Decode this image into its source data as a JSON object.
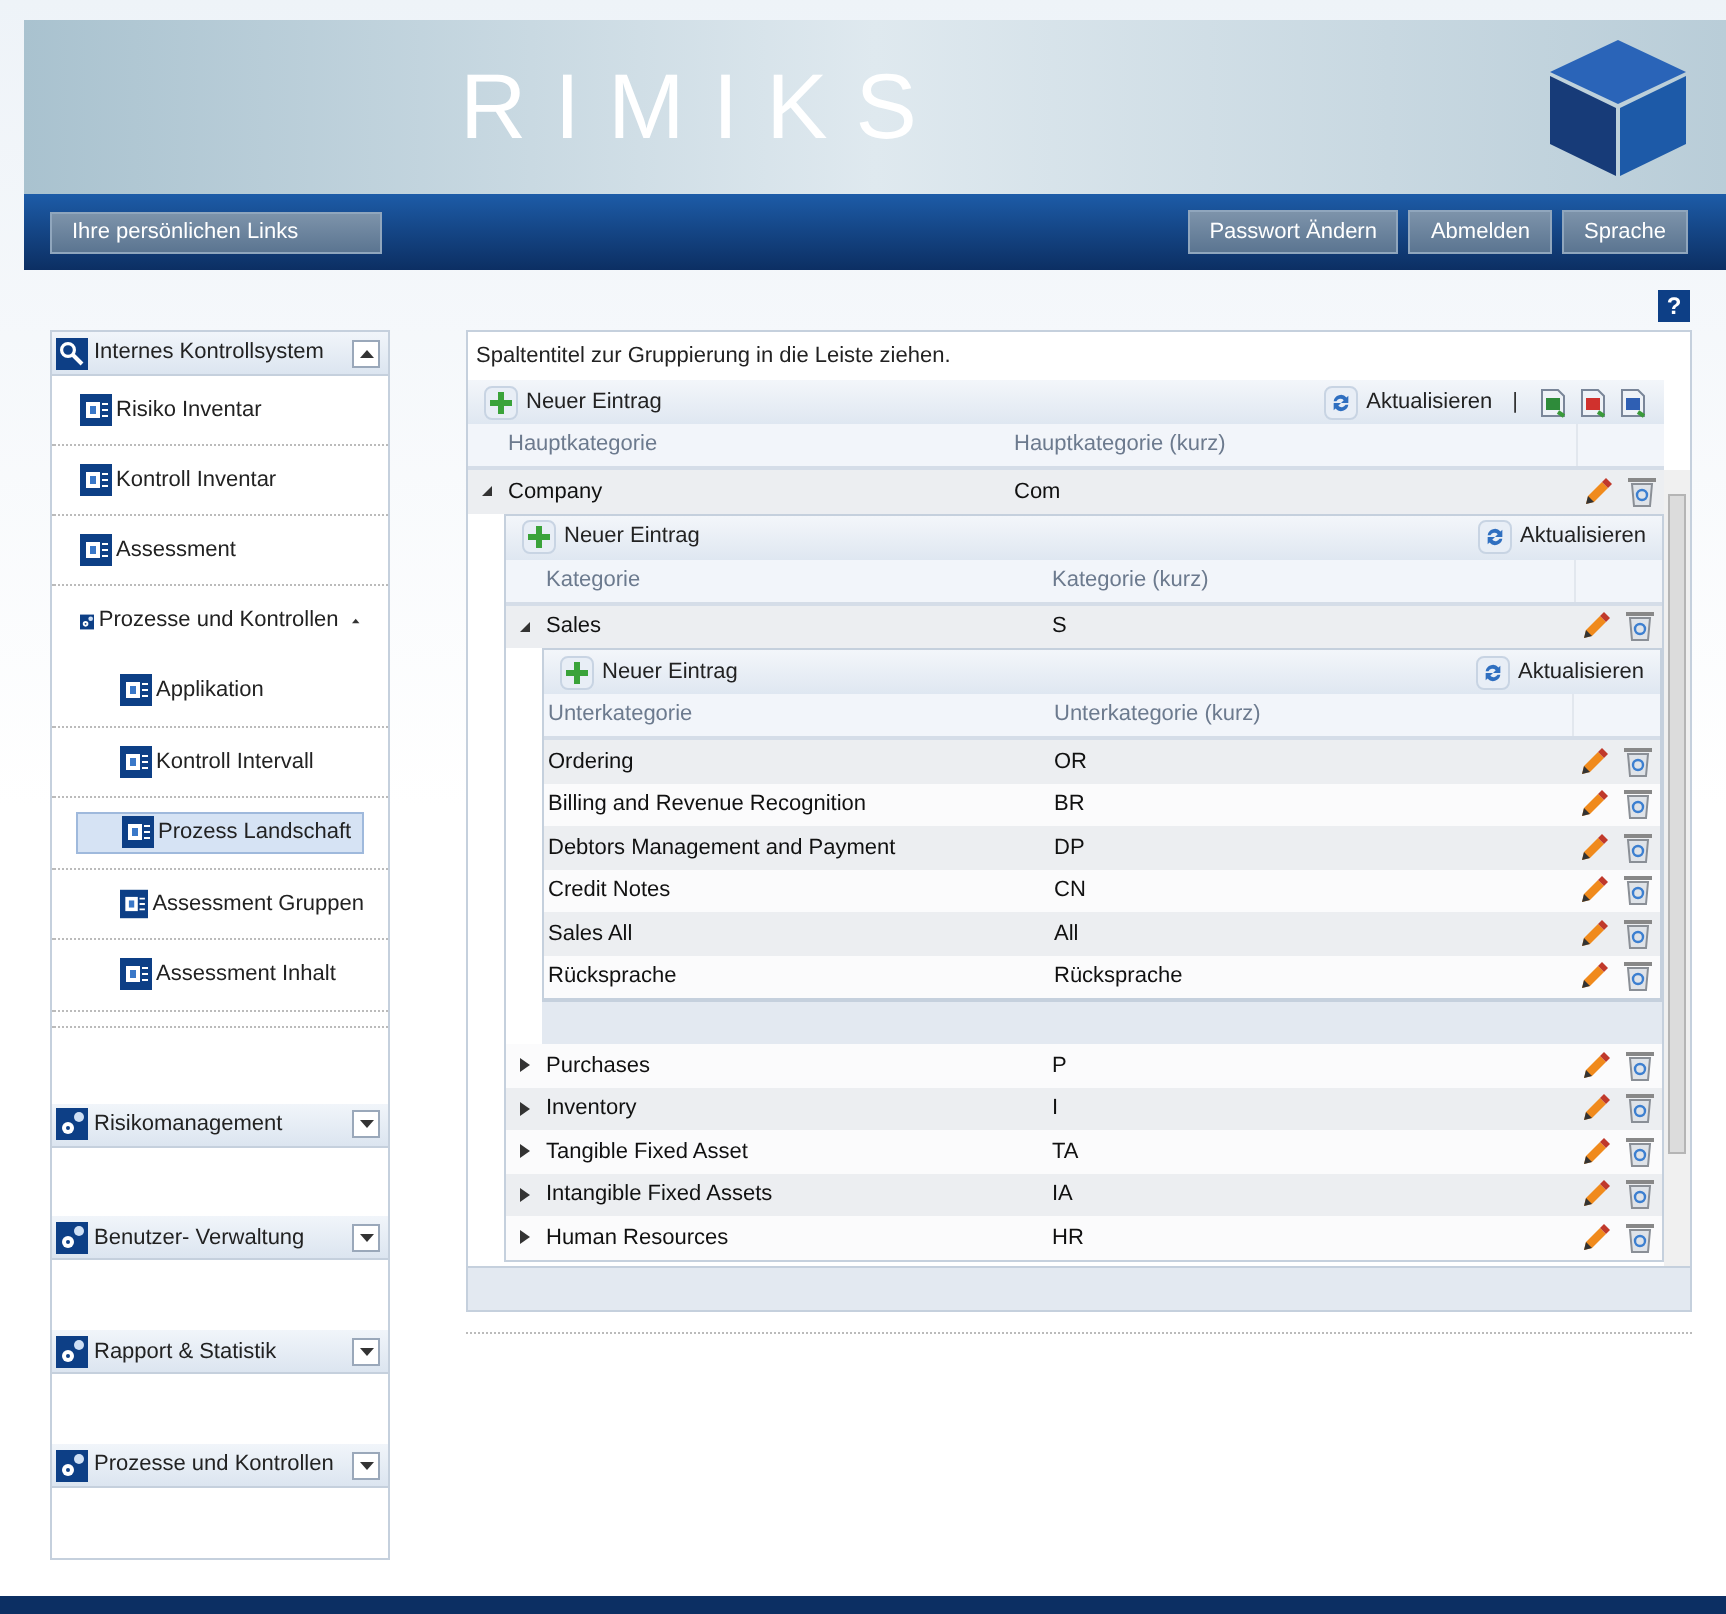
{
  "header": {
    "title": "RIMIKS",
    "links_button": "Ihre persönlichen Links",
    "buttons": [
      "Passwort Ändern",
      "Abmelden",
      "Sprache"
    ]
  },
  "help": "?",
  "sidebar": {
    "sections": [
      {
        "label": "Internes Kontrollsystem",
        "expanded": true,
        "items": [
          {
            "label": "Risiko Inventar",
            "selected": false
          },
          {
            "label": "Kontroll Inventar",
            "selected": false
          },
          {
            "label": "Assessment",
            "selected": false
          },
          {
            "label": "Prozesse und Kontrollen",
            "selected": false,
            "expanded": true,
            "children": [
              {
                "label": "Applikation",
                "selected": false
              },
              {
                "label": "Kontroll Intervall",
                "selected": false
              },
              {
                "label": "Prozess Landschaft",
                "selected": true
              },
              {
                "label": "Assessment Gruppen",
                "selected": false
              },
              {
                "label": "Assessment Inhalt",
                "selected": false
              }
            ]
          }
        ]
      },
      {
        "label": "Risikomanagement",
        "expanded": false
      },
      {
        "label": "Benutzer- Verwaltung",
        "expanded": false
      },
      {
        "label": "Rapport & Statistik",
        "expanded": false
      },
      {
        "label": "Prozesse und Kontrollen",
        "expanded": false
      }
    ]
  },
  "grid": {
    "hint": "Spaltentitel zur Gruppierung in die Leiste ziehen.",
    "toolbar": {
      "new": "Neuer Eintrag",
      "refresh": "Aktualisieren",
      "separator": "|",
      "export": true
    },
    "columns": [
      "Hauptkategorie",
      "Hauptkategorie (kurz)"
    ],
    "rows": [
      {
        "name": "Company",
        "short": "Com",
        "expanded": true,
        "detail": {
          "toolbar": {
            "new": "Neuer Eintrag",
            "refresh": "Aktualisieren"
          },
          "columns": [
            "Kategorie",
            "Kategorie (kurz)"
          ],
          "rows": [
            {
              "name": "Sales",
              "short": "S",
              "expanded": true,
              "detail": {
                "toolbar": {
                  "new": "Neuer Eintrag",
                  "refresh": "Aktualisieren"
                },
                "columns": [
                  "Unterkategorie",
                  "Unterkategorie (kurz)"
                ],
                "rows": [
                  {
                    "name": "Ordering",
                    "short": "OR"
                  },
                  {
                    "name": "Billing and Revenue Recognition",
                    "short": "BR"
                  },
                  {
                    "name": "Debtors Management and Payment",
                    "short": "DP"
                  },
                  {
                    "name": "Credit Notes",
                    "short": "CN"
                  },
                  {
                    "name": "Sales All",
                    "short": "All"
                  },
                  {
                    "name": "Rücksprache",
                    "short": "Rücksprache"
                  }
                ]
              }
            },
            {
              "name": "Purchases",
              "short": "P",
              "expanded": false
            },
            {
              "name": "Inventory",
              "short": "I",
              "expanded": false
            },
            {
              "name": "Tangible Fixed Asset",
              "short": "TA",
              "expanded": false
            },
            {
              "name": "Intangible Fixed Assets",
              "short": "IA",
              "expanded": false
            },
            {
              "name": "Human Resources",
              "short": "HR",
              "expanded": false
            }
          ]
        }
      }
    ]
  }
}
